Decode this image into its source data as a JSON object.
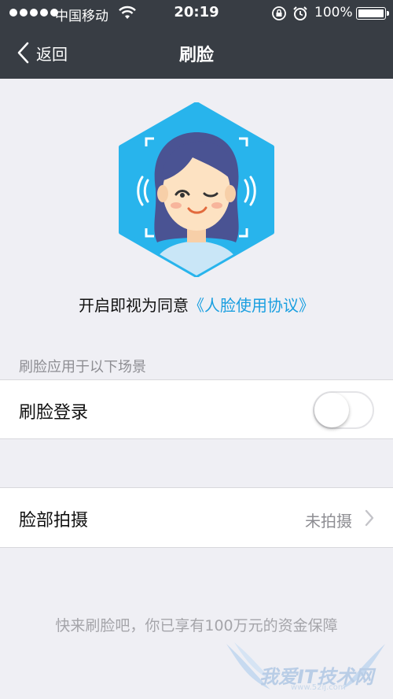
{
  "status_bar": {
    "carrier": "中国移动",
    "time": "20:19",
    "battery": "100%",
    "battery_level": 1.0
  },
  "nav": {
    "back_label": "返回",
    "title": "刷脸"
  },
  "agreement": {
    "prefix": "开启即视为同意",
    "link": "《人脸使用协议》"
  },
  "section_header": "刷脸应用于以下场景",
  "face_login": {
    "label": "刷脸登录",
    "enabled": false
  },
  "face_photo": {
    "label": "脸部拍摄",
    "value": "未拍摄"
  },
  "footer_note": "快来刷脸吧，你已享有100万元的资金保障",
  "watermark": {
    "text": "我爱IT技术网",
    "url": "www.52ij.com"
  },
  "colors": {
    "nav_background": "#383d44",
    "page_background": "#efeff4",
    "link_blue": "#1a9fe0",
    "hexagon_blue": "#28b4ec"
  }
}
